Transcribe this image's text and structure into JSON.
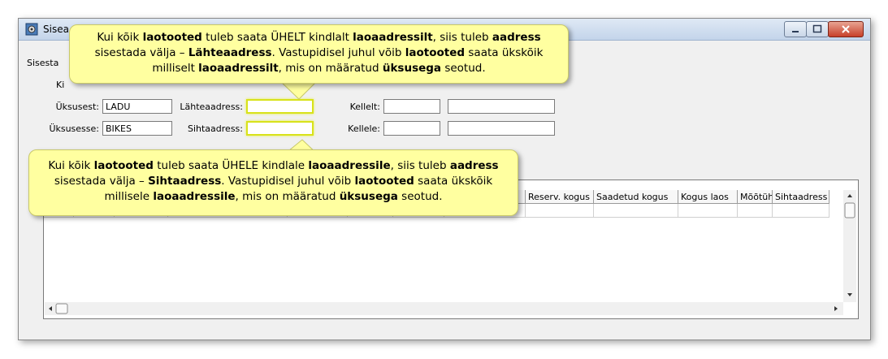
{
  "window": {
    "title": "Sisea"
  },
  "form": {
    "row1_label": "Sisesta",
    "row2_label": "Ki",
    "from_unit_label": "Üksusest:",
    "from_unit_value": "LADU",
    "to_unit_label": "Üksusesse:",
    "to_unit_value": "BIKES",
    "source_address_label": "Lähteaadress:",
    "target_address_label": "Sihtaadress:",
    "from_label": "Kellelt:",
    "to_label": "Kellele:"
  },
  "grid": {
    "columns": [
      "Reserv. kogus",
      "Saadetud kogus",
      "Kogus laos",
      "Mõõtühik",
      "Sihtaadress"
    ]
  },
  "callouts": {
    "top": {
      "parts": [
        "Kui kõik ",
        "laotooted",
        " tuleb saata ÜHELT kindlalt ",
        "laoaadressilt",
        ", siis tuleb ",
        "aadress",
        " sisestada välja – ",
        "Lähteaadress",
        ".  Vastupidisel juhul võib ",
        "laotooted",
        " saata ükskõik milliselt ",
        "laoaadressilt",
        ", mis on määratud ",
        "üksusega",
        " seotud."
      ]
    },
    "bottom": {
      "parts": [
        "Kui kõik ",
        "laotooted",
        " tuleb saata ÜHELE kindlale ",
        "laoaadressile",
        ", siis tuleb ",
        "aadress",
        " sisestada välja – ",
        "Sihtaadress",
        ". Vastupidisel juhul võib ",
        "laotooted",
        " saata ükskõik millisele ",
        "laoaadressile",
        ", mis on määratud ",
        "üksusega",
        " seotud."
      ]
    }
  }
}
